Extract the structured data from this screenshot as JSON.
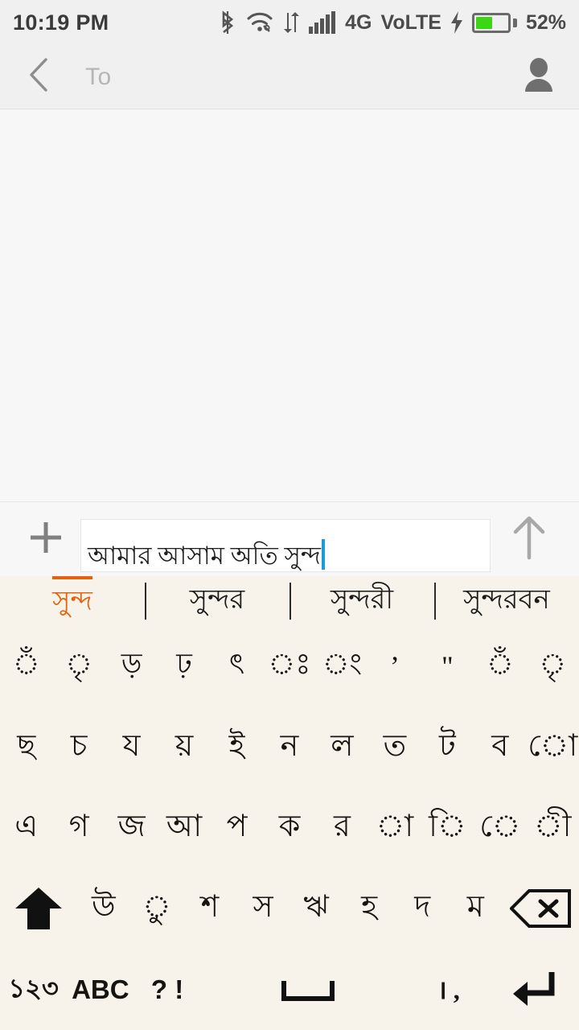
{
  "statusbar": {
    "time": "10:19 PM",
    "network_type": "4G",
    "volte_label": "VoLTE",
    "battery_percent": "52%",
    "battery_level": 52,
    "icons": [
      "bluetooth-icon",
      "wifi-icon",
      "data-transfer-icon",
      "signal-bars-icon",
      "charging-bolt-icon",
      "battery-icon"
    ],
    "bar_bg": "#eff0ef"
  },
  "appbar": {
    "back_icon": "chevron-left-icon",
    "to_placeholder": "To",
    "contact_icon": "person-icon"
  },
  "compose": {
    "attach_icon": "plus-icon",
    "message_value": "আমার আসাম অতি সুন্দ",
    "send_icon": "arrow-up-icon",
    "caret_color": "#1e9ad6"
  },
  "keyboard": {
    "bg": "#f8f3ea",
    "accent": "#e2630d",
    "suggestions": [
      {
        "label": "সুন্দ",
        "active": true
      },
      {
        "label": "সুন্দর",
        "active": false
      },
      {
        "label": "সুন্দরী",
        "active": false
      },
      {
        "label": "সুন্দরবন",
        "active": false
      }
    ],
    "rows": [
      [
        {
          "label": "ঁ",
          "type": "dia"
        },
        {
          "label": "ৃ",
          "type": "dia"
        },
        {
          "label": "ড়",
          "type": "dia"
        },
        {
          "label": "ঢ়",
          "type": "dia"
        },
        {
          "label": "ৎ",
          "type": "dia"
        },
        {
          "label": "ঃ",
          "type": "dia"
        },
        {
          "label": "ং",
          "type": "dia"
        },
        {
          "label": "’",
          "type": "dia"
        },
        {
          "label": "\"",
          "type": "dia"
        },
        {
          "label": "ঁ",
          "type": "dia"
        },
        {
          "label": "ৃ",
          "type": "dia"
        }
      ],
      [
        {
          "label": "ছ",
          "type": "letter"
        },
        {
          "label": "চ",
          "type": "letter"
        },
        {
          "label": "য",
          "type": "letter"
        },
        {
          "label": "য়",
          "type": "letter"
        },
        {
          "label": "ই",
          "type": "letter"
        },
        {
          "label": "ন",
          "type": "letter"
        },
        {
          "label": "ল",
          "type": "letter"
        },
        {
          "label": "ত",
          "type": "letter"
        },
        {
          "label": "ট",
          "type": "letter"
        },
        {
          "label": "ব",
          "type": "letter"
        },
        {
          "label": "ো",
          "type": "letter"
        }
      ],
      [
        {
          "label": "এ",
          "type": "letter"
        },
        {
          "label": "গ",
          "type": "letter"
        },
        {
          "label": "জ",
          "type": "letter"
        },
        {
          "label": "আ",
          "type": "letter"
        },
        {
          "label": "প",
          "type": "letter"
        },
        {
          "label": "ক",
          "type": "letter"
        },
        {
          "label": "র",
          "type": "letter"
        },
        {
          "label": "া",
          "type": "letter"
        },
        {
          "label": "ি",
          "type": "letter"
        },
        {
          "label": "ে",
          "type": "letter"
        },
        {
          "label": "ী",
          "type": "letter"
        }
      ],
      [
        {
          "label": "",
          "type": "shift",
          "icon": "shift-up-icon"
        },
        {
          "label": "উ",
          "type": "letter"
        },
        {
          "label": "ু",
          "type": "letter"
        },
        {
          "label": "শ",
          "type": "letter"
        },
        {
          "label": "স",
          "type": "letter"
        },
        {
          "label": "ঋ",
          "type": "letter"
        },
        {
          "label": "হ",
          "type": "letter"
        },
        {
          "label": "দ",
          "type": "letter"
        },
        {
          "label": "ম",
          "type": "letter"
        },
        {
          "label": "",
          "type": "backspace",
          "icon": "backspace-icon"
        }
      ],
      [
        {
          "label": "১২৩",
          "type": "numeric-switch"
        },
        {
          "label": "ABC",
          "type": "latin-switch"
        },
        {
          "label": "? !",
          "type": "symbols"
        },
        {
          "label": "",
          "type": "space",
          "icon": "space-icon"
        },
        {
          "label": "। ,",
          "type": "punctuation"
        },
        {
          "label": "",
          "type": "enter",
          "icon": "enter-icon"
        }
      ]
    ]
  }
}
